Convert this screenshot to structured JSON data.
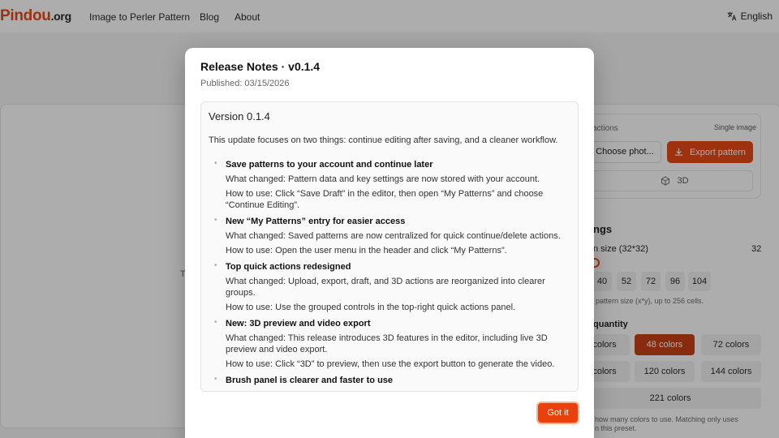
{
  "header": {
    "logo_main": "Pindou",
    "logo_tld": ".org",
    "nav": [
      "Image to Perler Pattern",
      "Blog",
      "About"
    ],
    "language": "English"
  },
  "background": {
    "left_text": "T",
    "quick_actions_label": "actions",
    "single_image": "Single image",
    "choose_photo": "Choose phot...",
    "export_pattern": "Export pattern",
    "three_d": "3D",
    "settings_heading": "ngs",
    "pattern_size_label": "n size (32*32)",
    "pattern_size_value": "32",
    "sizes": [
      "40",
      "52",
      "72",
      "96",
      "104"
    ],
    "size_hint": "pattern size (x*y), up to 256 cells.",
    "quantity_heading": "quantity",
    "colors": [
      "colors",
      "48 colors",
      "72 colors",
      "colors",
      "120 colors",
      "144 colors",
      "221 colors"
    ],
    "colors_hint_line1": "how many colors to use. Matching only uses",
    "colors_hint_line2": "n this preset."
  },
  "modal": {
    "title": "Release Notes · v0.1.4",
    "published": "Published: 03/15/2026",
    "version": "Version 0.1.4",
    "intro": "This update focuses on two things: continue editing after saving, and a cleaner workflow.",
    "items": [
      {
        "title": "Save patterns to your account and continue later",
        "lines": [
          "What changed: Pattern data and key settings are now stored with your account.",
          "How to use: Click “Save Draft” in the editor, then open “My Patterns” and choose “Continue Editing”."
        ]
      },
      {
        "title": "New “My Patterns” entry for easier access",
        "lines": [
          "What changed: Saved patterns are now centralized for quick continue/delete actions.",
          "How to use: Open the user menu in the header and click “My Patterns”."
        ]
      },
      {
        "title": "Top quick actions redesigned",
        "lines": [
          "What changed: Upload, export, draft, and 3D actions are reorganized into clearer groups.",
          "How to use: Use the grouped controls in the top-right quick actions panel."
        ]
      },
      {
        "title": "New: 3D preview and video export",
        "lines": [
          "What changed: This release introduces 3D features in the editor, including live 3D preview and video export.",
          "How to use: Click “3D” to preview, then use the export button to generate the video."
        ]
      },
      {
        "title": "Brush panel is clearer and faster to use",
        "lines": []
      }
    ],
    "got_it": "Got it"
  },
  "colors": {
    "brand": "#e8410c"
  }
}
